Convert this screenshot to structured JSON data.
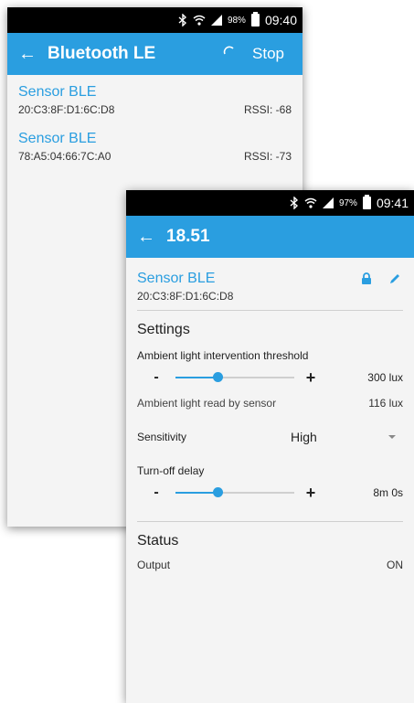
{
  "screen1": {
    "statusbar": {
      "battery_pct": "98%",
      "time": "09:40"
    },
    "appbar": {
      "title": "Bluetooth LE",
      "stop_label": "Stop"
    },
    "devices": [
      {
        "name": "Sensor BLE",
        "mac": "20:C3:8F:D1:6C:D8",
        "rssi": "RSSI: -68"
      },
      {
        "name": "Sensor BLE",
        "mac": "78:A5:04:66:7C:A0",
        "rssi": "RSSI: -73"
      }
    ]
  },
  "screen2": {
    "statusbar": {
      "battery_pct": "97%",
      "time": "09:41"
    },
    "appbar": {
      "title": "18.51"
    },
    "device": {
      "name": "Sensor BLE",
      "mac": "20:C3:8F:D1:6C:D8"
    },
    "settings": {
      "title": "Settings",
      "threshold": {
        "label": "Ambient light intervention threshold",
        "minus": "-",
        "plus": "+",
        "value": "300  lux",
        "level": 0.35
      },
      "ambient": {
        "label": "Ambient light read by sensor",
        "value": "116  lux"
      },
      "sensitivity": {
        "label": "Sensitivity",
        "value": "High"
      },
      "delay": {
        "label": "Turn-off delay",
        "minus": "-",
        "plus": "+",
        "value": "8m 0s",
        "level": 0.35
      }
    },
    "status": {
      "title": "Status",
      "output_label": "Output",
      "output_value": "ON"
    }
  },
  "colors": {
    "accent": "#2a9ee0",
    "statusbar": "#000000",
    "background": "#f4f4f4"
  },
  "icons": [
    "bluetooth-icon",
    "wifi-icon",
    "signal-icon",
    "battery-icon",
    "back-arrow-icon",
    "refresh-icon",
    "lock-icon",
    "pencil-icon",
    "dropdown-caret-icon"
  ]
}
